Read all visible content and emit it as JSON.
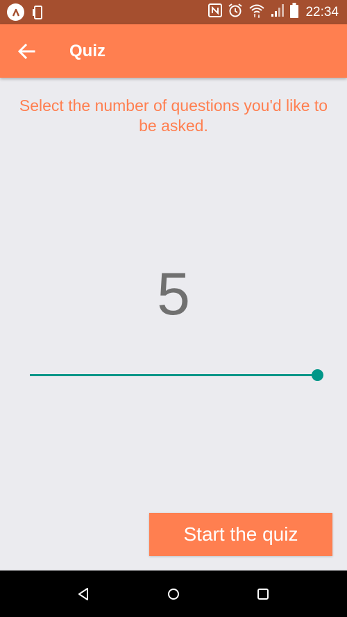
{
  "status_bar": {
    "time": "22:34",
    "icons": [
      "app-logo-icon",
      "phone-rotate-icon",
      "nfc-icon",
      "alarm-icon",
      "wifi-icon",
      "signal-icon",
      "battery-icon"
    ]
  },
  "app_bar": {
    "title": "Quiz",
    "back_icon": "arrow-left-icon"
  },
  "main": {
    "prompt": "Select the number of questions you'd like to be asked.",
    "count": "5",
    "slider": {
      "min": 1,
      "max": 5,
      "value": 5,
      "color": "#009688"
    }
  },
  "actions": {
    "start_label": "Start the quiz"
  },
  "nav_bar": {
    "icons": [
      "back-triangle-icon",
      "home-circle-icon",
      "recents-square-icon"
    ]
  },
  "colors": {
    "accent": "#ff7f50",
    "status_bar": "#a54f2f",
    "background": "#ebebef",
    "slider": "#009688"
  }
}
